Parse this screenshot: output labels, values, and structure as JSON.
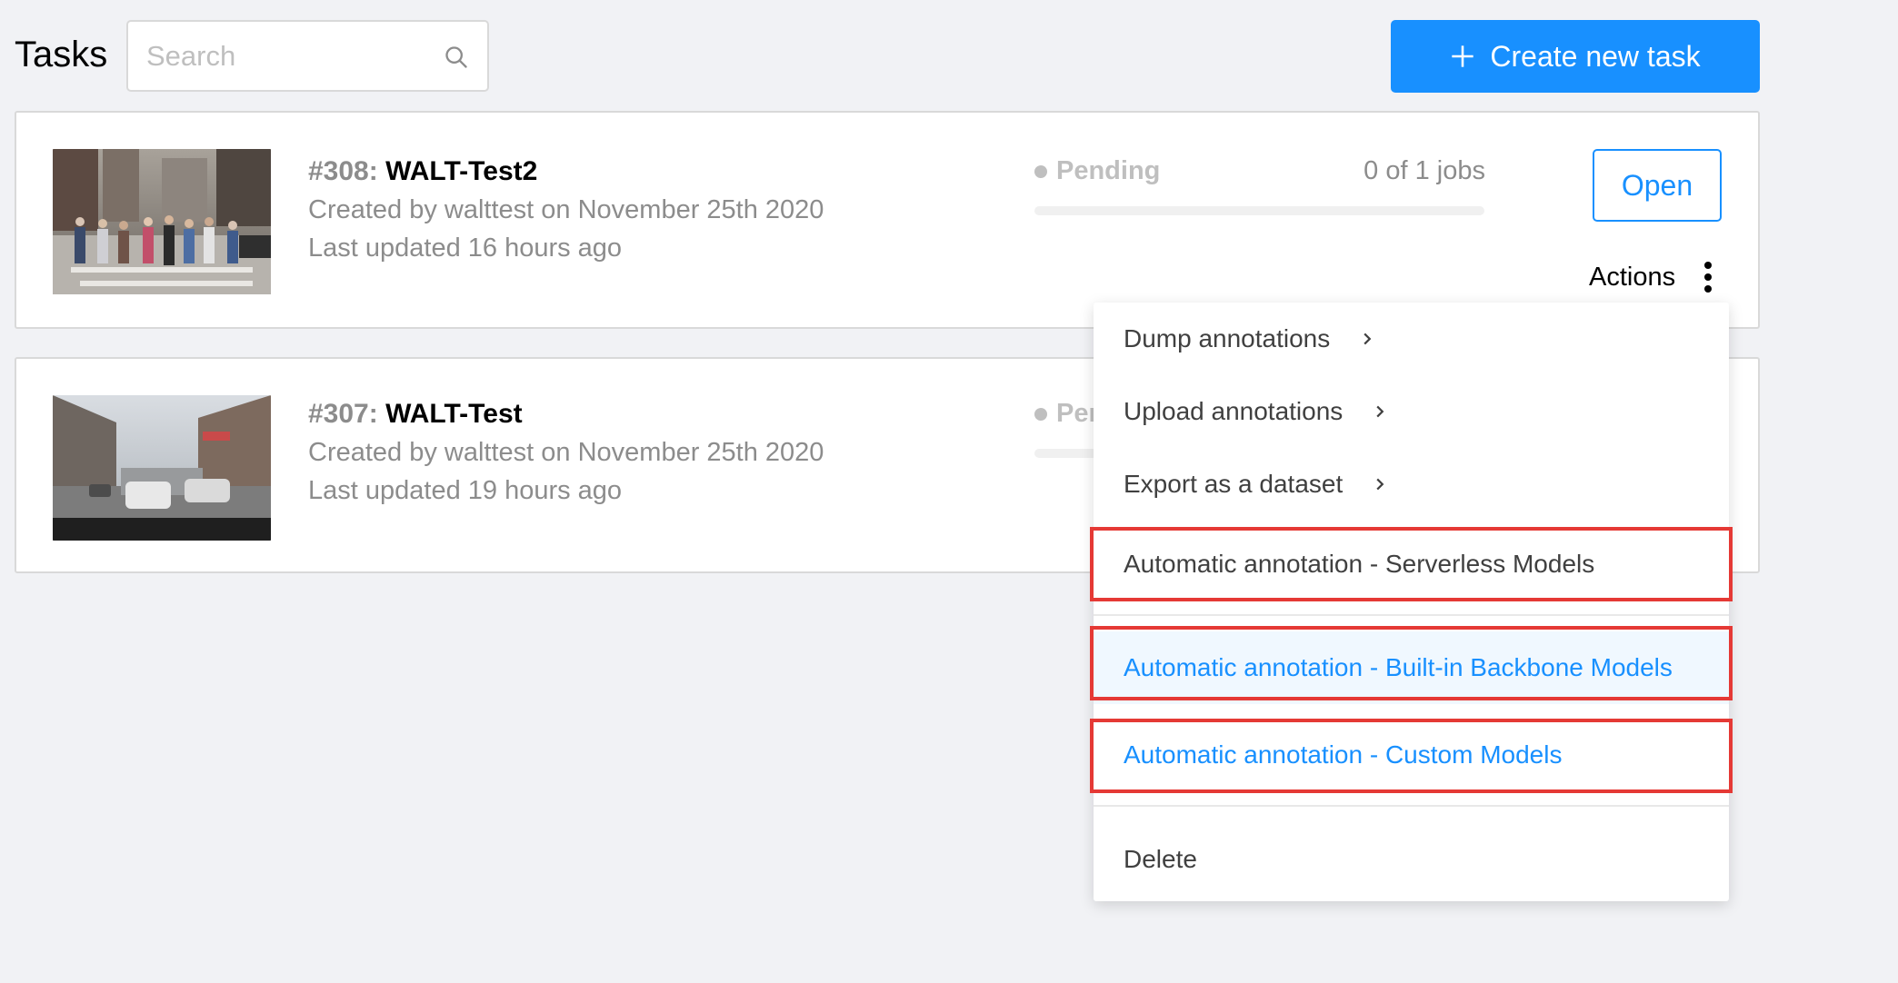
{
  "header": {
    "title": "Tasks",
    "search_placeholder": "Search",
    "search_value": "",
    "create_label": "Create new task"
  },
  "tasks": [
    {
      "id": "#308:",
      "name": "WALT-Test2",
      "created": "Created by walttest on November 25th 2020",
      "updated": "Last updated 16 hours ago",
      "status": "Pending",
      "jobs": "0 of 1 jobs",
      "progress": 0,
      "open_label": "Open",
      "actions_label": "Actions"
    },
    {
      "id": "#307:",
      "name": "WALT-Test",
      "created": "Created by walttest on November 25th 2020",
      "updated": "Last updated 19 hours ago",
      "status": "Per",
      "progress": 0
    }
  ],
  "actions_menu": {
    "items": [
      {
        "label": "Dump annotations",
        "has_submenu": true
      },
      {
        "label": "Upload annotations",
        "has_submenu": true
      },
      {
        "label": "Export as a dataset",
        "has_submenu": true
      },
      {
        "label": "Automatic annotation - Serverless Models",
        "highlighted": true
      },
      {
        "label": "Automatic annotation - Built-in Backbone Models",
        "highlighted": true,
        "color": "#1890ff"
      },
      {
        "label": "Automatic annotation - Custom Models",
        "highlighted": true,
        "color": "#1890ff"
      },
      {
        "label": "Delete"
      }
    ]
  },
  "colors": {
    "primary": "#1890ff",
    "highlight_border": "#e53935",
    "background": "#f1f2f5"
  },
  "icons": [
    "search-icon",
    "plus-icon",
    "kebab-icon",
    "chevron-right-icon"
  ]
}
